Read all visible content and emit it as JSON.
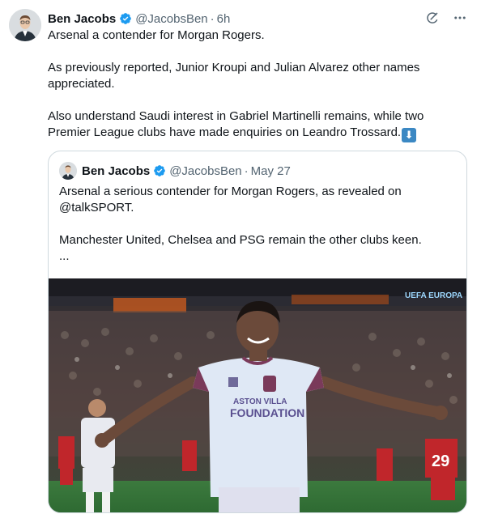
{
  "tweet": {
    "author_name": "Ben Jacobs",
    "handle": "@JacobsBen",
    "separator": "·",
    "time": "6h",
    "lines": [
      "Arsenal a contender for Morgan Rogers.",
      "As previously reported, Junior Kroupi and Julian Alvarez other names appreciated.",
      "Also understand Saudi interest in Gabriel Martinelli remains, while two Premier League clubs have made enquiries on Leandro Trossard."
    ],
    "emoji": "⬇"
  },
  "quote": {
    "author_name": "Ben Jacobs",
    "handle": "@JacobsBen",
    "separator": "·",
    "time": "May 27",
    "line1": "Arsenal a serious contender for Morgan Rogers, as revealed on @talkSPORT.",
    "line2": "Manchester United, Chelsea and PSG remain the other clubs keen.",
    "ellipsis": "...",
    "image": {
      "banner_text": "UEFA EUROPA",
      "shirt_line1": "ASTON VILLA",
      "shirt_line2": "FOUNDATION",
      "opponent_number": "29"
    }
  },
  "colors": {
    "verified": "#1d9bf0",
    "secondary_text": "#536471",
    "border": "#cfd9de"
  }
}
